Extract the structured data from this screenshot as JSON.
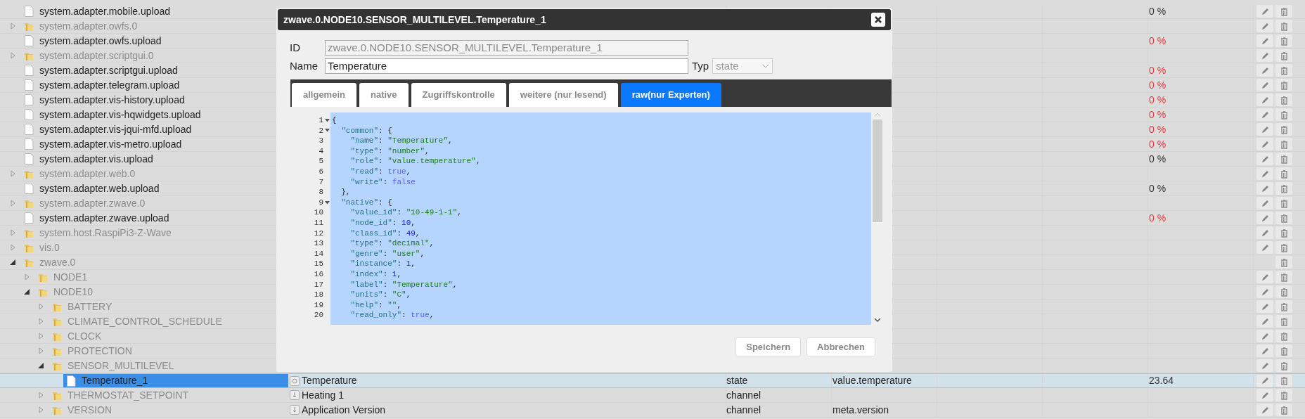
{
  "tree": [
    {
      "label": "system.adapter.mobile.upload",
      "kind": "file",
      "selected": false,
      "value": "0 %",
      "warning": false,
      "edit": true
    },
    {
      "label": "system.adapter.owfs.0",
      "kind": "folder",
      "expanded": false,
      "selected": false,
      "edit": true
    },
    {
      "label": "system.adapter.owfs.upload",
      "kind": "file",
      "selected": false,
      "value": "0 %",
      "warning": true,
      "edit": true
    },
    {
      "label": "system.adapter.scriptgui.0",
      "kind": "folder",
      "expanded": false,
      "selected": false,
      "edit": true
    },
    {
      "label": "system.adapter.scriptgui.upload",
      "kind": "file",
      "selected": false,
      "value": "0 %",
      "warning": true,
      "edit": true
    },
    {
      "label": "system.adapter.telegram.upload",
      "kind": "file",
      "selected": false,
      "value": "0 %",
      "warning": true,
      "edit": true
    },
    {
      "label": "system.adapter.vis-history.upload",
      "kind": "file",
      "selected": false,
      "value": "0 %",
      "warning": true,
      "edit": true
    },
    {
      "label": "system.adapter.vis-hqwidgets.upload",
      "kind": "file",
      "selected": false,
      "value": "0 %",
      "warning": true,
      "edit": true
    },
    {
      "label": "system.adapter.vis-jqui-mfd.upload",
      "kind": "file",
      "selected": false,
      "value": "0 %",
      "warning": true,
      "edit": true
    },
    {
      "label": "system.adapter.vis-metro.upload",
      "kind": "file",
      "selected": false,
      "value": "0 %",
      "warning": true,
      "edit": true
    },
    {
      "label": "system.adapter.vis.upload",
      "kind": "file",
      "selected": false,
      "value": "0 %",
      "warning": false,
      "edit": true
    },
    {
      "label": "system.adapter.web.0",
      "kind": "folder",
      "expanded": false,
      "selected": false,
      "edit": true
    },
    {
      "label": "system.adapter.web.upload",
      "kind": "file",
      "selected": false,
      "value": "0 %",
      "warning": false,
      "edit": true
    },
    {
      "label": "system.adapter.zwave.0",
      "kind": "folder",
      "expanded": false,
      "selected": false,
      "edit": true
    },
    {
      "label": "system.adapter.zwave.upload",
      "kind": "file",
      "selected": false,
      "value": "0 %",
      "warning": true,
      "edit": true
    },
    {
      "label": "system.host.RaspiPi3-Z-Wave",
      "kind": "folder",
      "expanded": false,
      "selected": false,
      "edit": true
    },
    {
      "label": "vis.0",
      "kind": "folder",
      "expanded": false,
      "selected": false,
      "edit": true
    },
    {
      "label": "zwave.0",
      "kind": "folder",
      "expanded": true,
      "selected": false,
      "edit": false,
      "children": [
        {
          "label": "NODE1",
          "kind": "folder",
          "expanded": false,
          "selected": false,
          "edit": true
        },
        {
          "label": "NODE10",
          "kind": "folder",
          "expanded": true,
          "selected": false,
          "edit": true,
          "children": [
            {
              "label": "BATTERY",
              "kind": "folder",
              "expanded": false,
              "selected": false,
              "edit": true
            },
            {
              "label": "CLIMATE_CONTROL_SCHEDULE",
              "kind": "folder",
              "expanded": false,
              "selected": false,
              "edit": true
            },
            {
              "label": "CLOCK",
              "kind": "folder",
              "expanded": false,
              "selected": false,
              "edit": true
            },
            {
              "label": "PROTECTION",
              "kind": "folder",
              "expanded": false,
              "selected": false,
              "edit": true
            },
            {
              "label": "SENSOR_MULTILEVEL",
              "kind": "folder",
              "expanded": true,
              "selected": false,
              "edit": true,
              "children": [
                {
                  "label": "Temperature_1",
                  "kind": "file",
                  "selected": true,
                  "object": {
                    "kind": "state",
                    "name": "Temperature",
                    "type": "state",
                    "role": "value.temperature"
                  },
                  "value": "23.64",
                  "warning": false,
                  "edit": true
                }
              ]
            },
            {
              "label": "THERMOSTAT_SETPOINT",
              "kind": "folder",
              "expanded": false,
              "selected": false,
              "object": {
                "kind": "channel",
                "name": "Heating 1",
                "type": "channel"
              },
              "edit": true
            },
            {
              "label": "VERSION",
              "kind": "folder",
              "expanded": false,
              "selected": false,
              "object": {
                "kind": "channel",
                "name": "Application Version",
                "type": "channel",
                "role": "meta.version"
              },
              "edit": true
            }
          ]
        }
      ]
    }
  ],
  "dialog": {
    "title": "zwave.0.NODE10.SENSOR_MULTILEVEL.Temperature_1",
    "id_label": "ID",
    "id_value": "zwave.0.NODE10.SENSOR_MULTILEVEL.Temperature_1",
    "name_label": "Name",
    "name_value": "Temperature",
    "type_label": "Typ",
    "type_value": "state",
    "tabs": [
      {
        "label": "allgemein",
        "selected": false
      },
      {
        "label": "native",
        "selected": false
      },
      {
        "label": "Zugriffskontrolle",
        "selected": false
      },
      {
        "label": "weitere (nur lesend)",
        "selected": false
      },
      {
        "label": "raw(nur Experten)",
        "selected": true
      }
    ],
    "code": [
      {
        "number": "1",
        "fold": true,
        "tokens": [
          {
            "kind": "punct",
            "text": "{"
          }
        ]
      },
      {
        "number": "2",
        "fold": true,
        "tokens": [
          {
            "kind": "key",
            "text": "  \"common\""
          },
          {
            "kind": "punct",
            "text": ": {"
          }
        ]
      },
      {
        "number": "3",
        "fold": false,
        "tokens": [
          {
            "kind": "key",
            "text": "    \"name\""
          },
          {
            "kind": "punct",
            "text": ": "
          },
          {
            "kind": "string",
            "text": "\"Temperature\""
          },
          {
            "kind": "punct",
            "text": ","
          }
        ]
      },
      {
        "number": "4",
        "fold": false,
        "tokens": [
          {
            "kind": "key",
            "text": "    \"type\""
          },
          {
            "kind": "punct",
            "text": ": "
          },
          {
            "kind": "string",
            "text": "\"number\""
          },
          {
            "kind": "punct",
            "text": ","
          }
        ]
      },
      {
        "number": "5",
        "fold": false,
        "tokens": [
          {
            "kind": "key",
            "text": "    \"role\""
          },
          {
            "kind": "punct",
            "text": ": "
          },
          {
            "kind": "string",
            "text": "\"value.temperature\""
          },
          {
            "kind": "punct",
            "text": ","
          }
        ]
      },
      {
        "number": "6",
        "fold": false,
        "tokens": [
          {
            "kind": "key",
            "text": "    \"read\""
          },
          {
            "kind": "punct",
            "text": ": "
          },
          {
            "kind": "boolean",
            "text": "true"
          },
          {
            "kind": "punct",
            "text": ","
          }
        ]
      },
      {
        "number": "7",
        "fold": false,
        "tokens": [
          {
            "kind": "key",
            "text": "    \"write\""
          },
          {
            "kind": "punct",
            "text": ": "
          },
          {
            "kind": "boolean",
            "text": "false"
          }
        ]
      },
      {
        "number": "8",
        "fold": false,
        "tokens": [
          {
            "kind": "punct",
            "text": "  },"
          }
        ]
      },
      {
        "number": "9",
        "fold": true,
        "tokens": [
          {
            "kind": "key",
            "text": "  \"native\""
          },
          {
            "kind": "punct",
            "text": ": {"
          }
        ]
      },
      {
        "number": "10",
        "fold": false,
        "tokens": [
          {
            "kind": "key",
            "text": "    \"value_id\""
          },
          {
            "kind": "punct",
            "text": ": "
          },
          {
            "kind": "string",
            "text": "\"10-49-1-1\""
          },
          {
            "kind": "punct",
            "text": ","
          }
        ]
      },
      {
        "number": "11",
        "fold": false,
        "tokens": [
          {
            "kind": "key",
            "text": "    \"node_id\""
          },
          {
            "kind": "punct",
            "text": ": "
          },
          {
            "kind": "number",
            "text": "10"
          },
          {
            "kind": "punct",
            "text": ","
          }
        ]
      },
      {
        "number": "12",
        "fold": false,
        "tokens": [
          {
            "kind": "key",
            "text": "    \"class_id\""
          },
          {
            "kind": "punct",
            "text": ": "
          },
          {
            "kind": "number",
            "text": "49"
          },
          {
            "kind": "punct",
            "text": ","
          }
        ]
      },
      {
        "number": "13",
        "fold": false,
        "tokens": [
          {
            "kind": "key",
            "text": "    \"type\""
          },
          {
            "kind": "punct",
            "text": ": "
          },
          {
            "kind": "string",
            "text": "\"decimal\""
          },
          {
            "kind": "punct",
            "text": ","
          }
        ]
      },
      {
        "number": "14",
        "fold": false,
        "tokens": [
          {
            "kind": "key",
            "text": "    \"genre\""
          },
          {
            "kind": "punct",
            "text": ": "
          },
          {
            "kind": "string",
            "text": "\"user\""
          },
          {
            "kind": "punct",
            "text": ","
          }
        ]
      },
      {
        "number": "15",
        "fold": false,
        "tokens": [
          {
            "kind": "key",
            "text": "    \"instance\""
          },
          {
            "kind": "punct",
            "text": ": "
          },
          {
            "kind": "number",
            "text": "1"
          },
          {
            "kind": "punct",
            "text": ","
          }
        ]
      },
      {
        "number": "16",
        "fold": false,
        "tokens": [
          {
            "kind": "key",
            "text": "    \"index\""
          },
          {
            "kind": "punct",
            "text": ": "
          },
          {
            "kind": "number",
            "text": "1"
          },
          {
            "kind": "punct",
            "text": ","
          }
        ]
      },
      {
        "number": "17",
        "fold": false,
        "tokens": [
          {
            "kind": "key",
            "text": "    \"label\""
          },
          {
            "kind": "punct",
            "text": ": "
          },
          {
            "kind": "string",
            "text": "\"Temperature\""
          },
          {
            "kind": "punct",
            "text": ","
          }
        ]
      },
      {
        "number": "18",
        "fold": false,
        "tokens": [
          {
            "kind": "key",
            "text": "    \"units\""
          },
          {
            "kind": "punct",
            "text": ": "
          },
          {
            "kind": "string",
            "text": "\"C\""
          },
          {
            "kind": "punct",
            "text": ","
          }
        ]
      },
      {
        "number": "19",
        "fold": false,
        "tokens": [
          {
            "kind": "key",
            "text": "    \"help\""
          },
          {
            "kind": "punct",
            "text": ": "
          },
          {
            "kind": "string",
            "text": "\"\""
          },
          {
            "kind": "punct",
            "text": ","
          }
        ]
      },
      {
        "number": "20",
        "fold": false,
        "tokens": [
          {
            "kind": "key",
            "text": "    \"read_only\""
          },
          {
            "kind": "punct",
            "text": ": "
          },
          {
            "kind": "boolean",
            "text": "true"
          },
          {
            "kind": "punct",
            "text": ","
          }
        ]
      }
    ],
    "buttons": [
      "Speichern",
      "Abbrechen"
    ]
  }
}
